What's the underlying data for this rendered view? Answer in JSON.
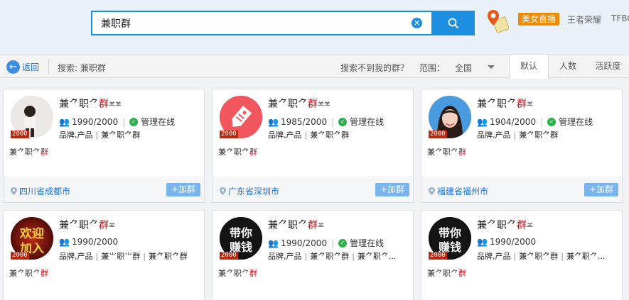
{
  "search": {
    "value": "兼职群"
  },
  "topbar": {
    "live_label": "美女直播",
    "link_1": "王者荣耀",
    "link_2": "TFBO"
  },
  "filter": {
    "back_label": "返回",
    "search_label": "搜索: 兼职群",
    "notfound_label": "搜索不到我的群？",
    "range_label": "范围：",
    "range_value": "全国",
    "sort_tabs": [
      "默认",
      "人数",
      "活跃度"
    ]
  },
  "cards": [
    {
      "name_a": "兼",
      "name_b": "⺈职⺈",
      "name_red": "群",
      "name_tail": "⺷⺷",
      "members": "1990/2000",
      "managed": "管理在线",
      "tags": [
        "品牌,产品",
        "兼⺈职⺈群"
      ],
      "desc_a": "兼⺈职⺈",
      "desc_red": "群",
      "location": "四川省成都市",
      "join": "+加群",
      "badge": "2000",
      "avatar": "girl-photo"
    },
    {
      "name_a": "兼",
      "name_b": "⺈职⺈",
      "name_red": "群",
      "name_tail": "⺷⺷",
      "members": "1985/2000",
      "managed": "管理在线",
      "tags": [
        "品牌,产品",
        "兼⺈职⺈群"
      ],
      "desc_a": "兼⺈职⺈",
      "desc_red": "群",
      "location": "广东省深圳市",
      "join": "+加群",
      "badge": "2000",
      "avatar": "tag-icon"
    },
    {
      "name_a": "兼",
      "name_b": "⺈职⺈",
      "name_red": "群",
      "name_tail": "⺷",
      "members": "1904/2000",
      "managed": "管理在线",
      "tags": [
        "品牌,产品",
        "兼⺈职⺈群"
      ],
      "desc_a": "兼⺈职⺈",
      "desc_red": "群",
      "location": "福建省福州市",
      "join": "+加群",
      "badge": "2000",
      "avatar": "woman-photo"
    },
    {
      "name_a": "兼",
      "name_b": "⺈职⺈",
      "name_red": "群",
      "name_tail": "⺷",
      "members": "1990/2000",
      "managed": "",
      "tags": [
        "品牌,产品",
        "兼⺌职⺌群",
        "兼⺈职⺈群"
      ],
      "desc_a": "兼⺈职⺈",
      "desc_red": "群",
      "badge": "2000",
      "avatar": "welcome-text",
      "avatar_text": "欢迎加入"
    },
    {
      "name_a": "兼",
      "name_b": "⺈职⺈",
      "name_red": "群",
      "name_tail": "⺷",
      "members": "1990/2000",
      "managed": "管理在线",
      "tags": [
        "品牌,产品",
        "兼⺈职⺈群",
        "兼⺈职⺈..."
      ],
      "desc_a": "兼⺈职⺈",
      "desc_red": "群",
      "badge": "2000",
      "avatar": "money-text",
      "avatar_text": "带你赚钱"
    },
    {
      "name_a": "兼",
      "name_b": "⺈职⺈",
      "name_red": "群",
      "name_tail": "⺷",
      "members": "1990/2000",
      "managed": "",
      "tags": [
        "品牌,产品",
        "兼⺈职⺈群",
        "兼⺈职⺈..."
      ],
      "desc_a": "兼⺈职⺈",
      "desc_red": "群",
      "badge": "2000",
      "avatar": "money-text",
      "avatar_text": "带你赚钱"
    }
  ]
}
